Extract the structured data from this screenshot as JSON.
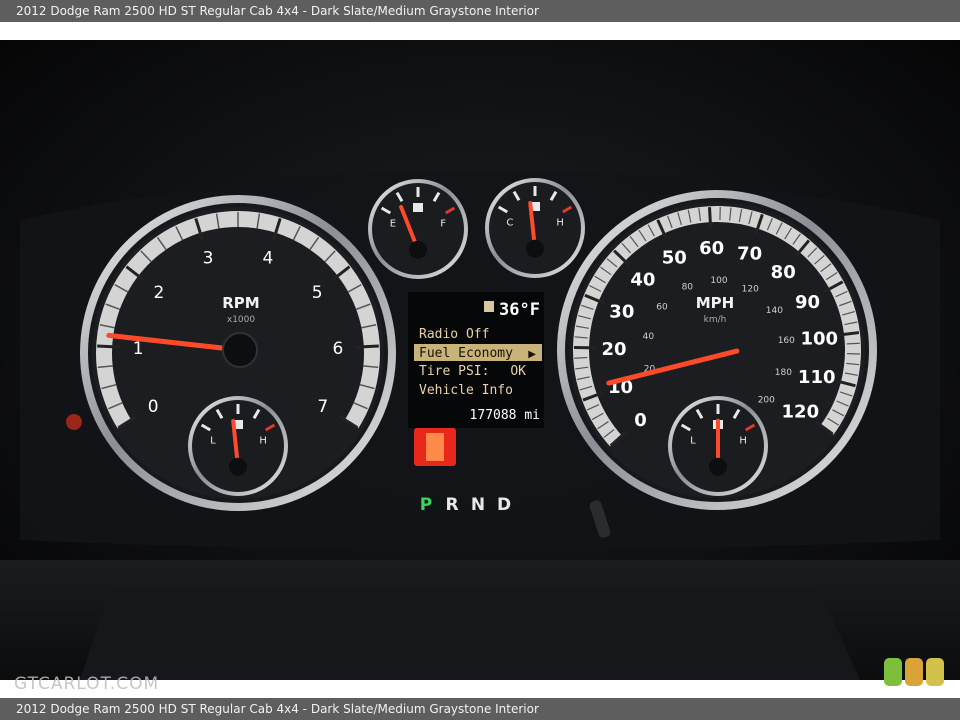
{
  "caption": "2012 Dodge Ram 2500 HD ST Regular Cab 4x4 - Dark Slate/Medium Graystone Interior",
  "watermark": "GTCARLOT.COM",
  "tachometer": {
    "label": "RPM",
    "unit": "x1000",
    "ticks": [
      "0",
      "1",
      "2",
      "3",
      "4",
      "5",
      "6",
      "7"
    ],
    "needle_value": 1.1
  },
  "speedometer": {
    "label": "MPH",
    "unit": "km/h",
    "mph_ticks": [
      "0",
      "10",
      "20",
      "30",
      "40",
      "50",
      "60",
      "70",
      "80",
      "90",
      "100",
      "110",
      "120"
    ],
    "kmh_ticks": [
      "20",
      "40",
      "60",
      "80",
      "100",
      "120",
      "140",
      "160",
      "180",
      "200"
    ],
    "needle_value": 13
  },
  "fuel_gauge": {
    "empty": "E",
    "full": "F",
    "level": 0.3
  },
  "temp_gauge": {
    "cold": "C",
    "hot": "H",
    "level": 0.4
  },
  "battery_gauge": {
    "low": "L",
    "high": "H",
    "level": 0.45
  },
  "oil_gauge": {
    "low": "L",
    "high": "H",
    "level": 0.5
  },
  "evic": {
    "temperature": "36°F",
    "menu": [
      "Radio Off",
      "Fuel Economy",
      "Tire PSI:",
      "Vehicle Info"
    ],
    "selected_index": 1,
    "tire_status": "OK",
    "odometer": "177088 mi"
  },
  "gear_selector": {
    "gears": [
      "P",
      "R",
      "N",
      "D"
    ],
    "active": "P"
  },
  "colors": {
    "needle": "#ff4a2a",
    "gear_active": "#3bd45a",
    "display_text": "#e8d2a8",
    "highlight": "#c8b37a"
  }
}
